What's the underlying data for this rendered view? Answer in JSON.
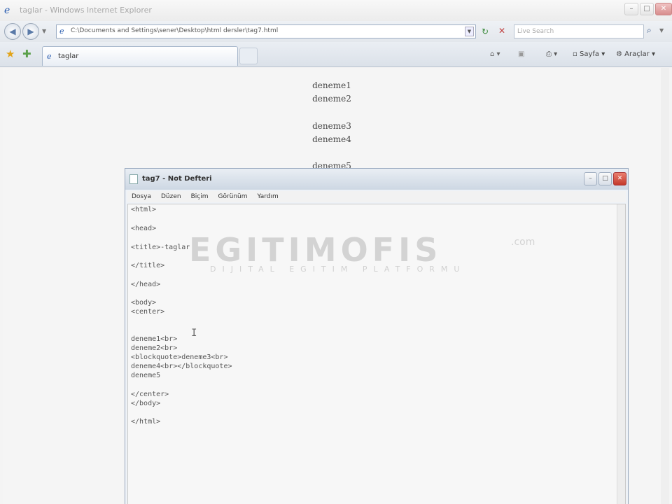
{
  "browser": {
    "title": "taglar - Windows Internet Explorer",
    "address": "C:\\Documents and Settings\\sener\\Desktop\\html dersler\\tag7.html",
    "search_placeholder": "Live Search",
    "tab_label": "taglar",
    "commands": {
      "page": "Sayfa",
      "tools": "Araçlar"
    }
  },
  "page_content": [
    "deneme1",
    "deneme2",
    "deneme3",
    "deneme4",
    "deneme5"
  ],
  "notepad": {
    "title": "tag7 - Not Defteri",
    "menu": [
      "Dosya",
      "Düzen",
      "Biçim",
      "Görünüm",
      "Yardım"
    ],
    "lines": [
      "<html>",
      "<head>",
      "<title>-taglar",
      "</title>",
      "</head>",
      "<body>",
      "<center>",
      "deneme1<br>",
      "deneme2<br>",
      "<blockquote>deneme3<br>",
      "deneme4<br></blockquote>",
      "deneme5",
      "</center>",
      "</body>",
      "</html>"
    ]
  },
  "watermark": {
    "main": "EGITIMOFIS",
    "suffix": ".com",
    "tagline": "DIJITAL EGITIM PLATFORMU"
  }
}
